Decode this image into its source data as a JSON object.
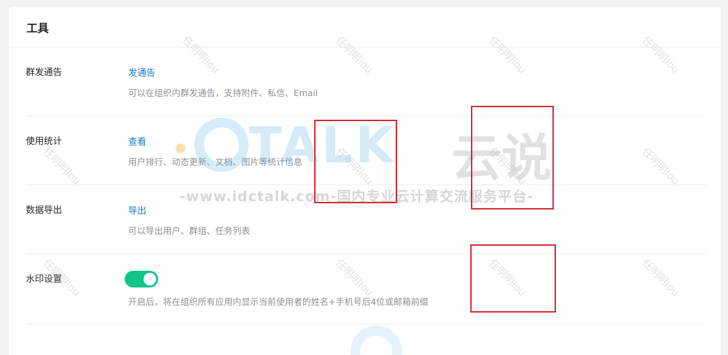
{
  "panel": {
    "title": "工具"
  },
  "rows": [
    {
      "label": "群发通告",
      "action": "发通告",
      "description": "可以在组织内群发通告，支持附件、私信、Email"
    },
    {
      "label": "使用统计",
      "action": "查看",
      "description": "用户排行、动态更新、文档、图片等统计信息"
    },
    {
      "label": "数据导出",
      "action": "导出",
      "description": "可以导出用户、群组、任务列表"
    },
    {
      "label": "水印设置",
      "toggle": {
        "state": "on"
      },
      "description": "开启后，将在组织所有应用内显示当前使用者的姓名+手机号后4位或邮箱前缀"
    }
  ],
  "watermark": {
    "brand_talk": "TALK",
    "brand_cn": "云说",
    "url_line": "-www.idctalk.com-国内专业云计算交流服务平台-",
    "repeat_text": "任明明lou"
  },
  "colors": {
    "link": "#1677c9",
    "toggle_on": "#11c58a",
    "annotation": "#d9262b"
  }
}
